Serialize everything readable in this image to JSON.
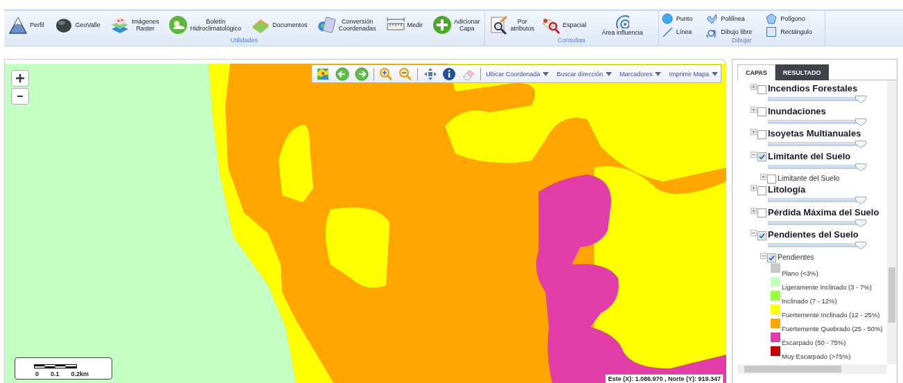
{
  "ribbon": {
    "groups": [
      {
        "label": "Utilidades",
        "buttons": [
          {
            "label": "Perfil",
            "kind": "large"
          },
          {
            "label": "GeoValle",
            "kind": "large"
          },
          {
            "label": "Imágenes\nRaster",
            "kind": "large"
          },
          {
            "label": "Boletín\nHidroclimatológico",
            "kind": "large"
          },
          {
            "label": "Documentos",
            "kind": "large"
          },
          {
            "label": "Conversión\nCoordenadas",
            "kind": "large"
          },
          {
            "label": "Medir",
            "kind": "large"
          },
          {
            "label": "Adicionar\nCapa",
            "kind": "large"
          }
        ]
      },
      {
        "label": "Consultas",
        "buttons": [
          {
            "label": "Por\natributos",
            "kind": "large"
          },
          {
            "label": "Espacial",
            "kind": "large"
          },
          {
            "label": "Área influencia",
            "kind": "top"
          }
        ]
      },
      {
        "label": "Dibujar",
        "buttons": [
          {
            "label": "Punto",
            "kind": "small"
          },
          {
            "label": "Línea",
            "kind": "small"
          },
          {
            "label": "Polilínea",
            "kind": "small"
          },
          {
            "label": "Dibujo libre",
            "kind": "small"
          },
          {
            "label": "Polígono",
            "kind": "small"
          },
          {
            "label": "Rectángulo",
            "kind": "small"
          }
        ]
      }
    ]
  },
  "map": {
    "toolbar": {
      "menus": [
        "Ubicar Coordenada",
        "Buscar dirección",
        "Marcadores",
        "Imprimir Mapa"
      ]
    },
    "scale": {
      "labels": [
        "0",
        "0.1",
        "0.2km"
      ]
    },
    "coordinates": "Este (X): 1.086.970 , Norte (Y): 919.347"
  },
  "layers_panel": {
    "tabs": [
      {
        "label": "CAPAS",
        "selected": true
      },
      {
        "label": "RESULTADO",
        "selected": false
      }
    ],
    "layers": [
      {
        "label": "Incendios Forestales",
        "checked": false,
        "expanded": false,
        "level": 0.92
      },
      {
        "label": "Inundaciones",
        "checked": false,
        "expanded": false,
        "level": 0.92
      },
      {
        "label": "Isoyetas Multianuales",
        "checked": false,
        "expanded": false,
        "level": 0.92
      },
      {
        "label": "Limitante del Suelo",
        "checked": true,
        "expanded": true,
        "level": 0.92,
        "children": [
          {
            "label": "Limitante del Suelo",
            "checked": false,
            "expanded": false
          }
        ]
      },
      {
        "label": "Litología",
        "checked": false,
        "expanded": false,
        "level": 0.92
      },
      {
        "label": "Pérdida Máxima del Suelo",
        "checked": false,
        "expanded": false,
        "level": 0.92
      },
      {
        "label": "Pendientes del Suelo",
        "checked": true,
        "expanded": true,
        "level": 0.92,
        "children": [
          {
            "label": "Pendientes",
            "checked": true,
            "expanded": true,
            "legend": [
              {
                "label": "Plano (<3%)",
                "color": "#c8c8c8"
              },
              {
                "label": "Ligeramente Inclinado (3 - 7%)",
                "color": "#c4ffc4"
              },
              {
                "label": "Inclinado (7 - 12%)",
                "color": "#99ff44"
              },
              {
                "label": "Fuertemente Inclinado (12 - 25%)",
                "color": "#ffff00"
              },
              {
                "label": "Fuertemente Quebrado (25 - 50%)",
                "color": "#ffa500"
              },
              {
                "label": "Escarpado (50 - 75%)",
                "color": "#e23ca8"
              },
              {
                "label": "Muy Escarpado (>75%)",
                "color": "#c80000"
              }
            ]
          }
        ]
      }
    ]
  }
}
